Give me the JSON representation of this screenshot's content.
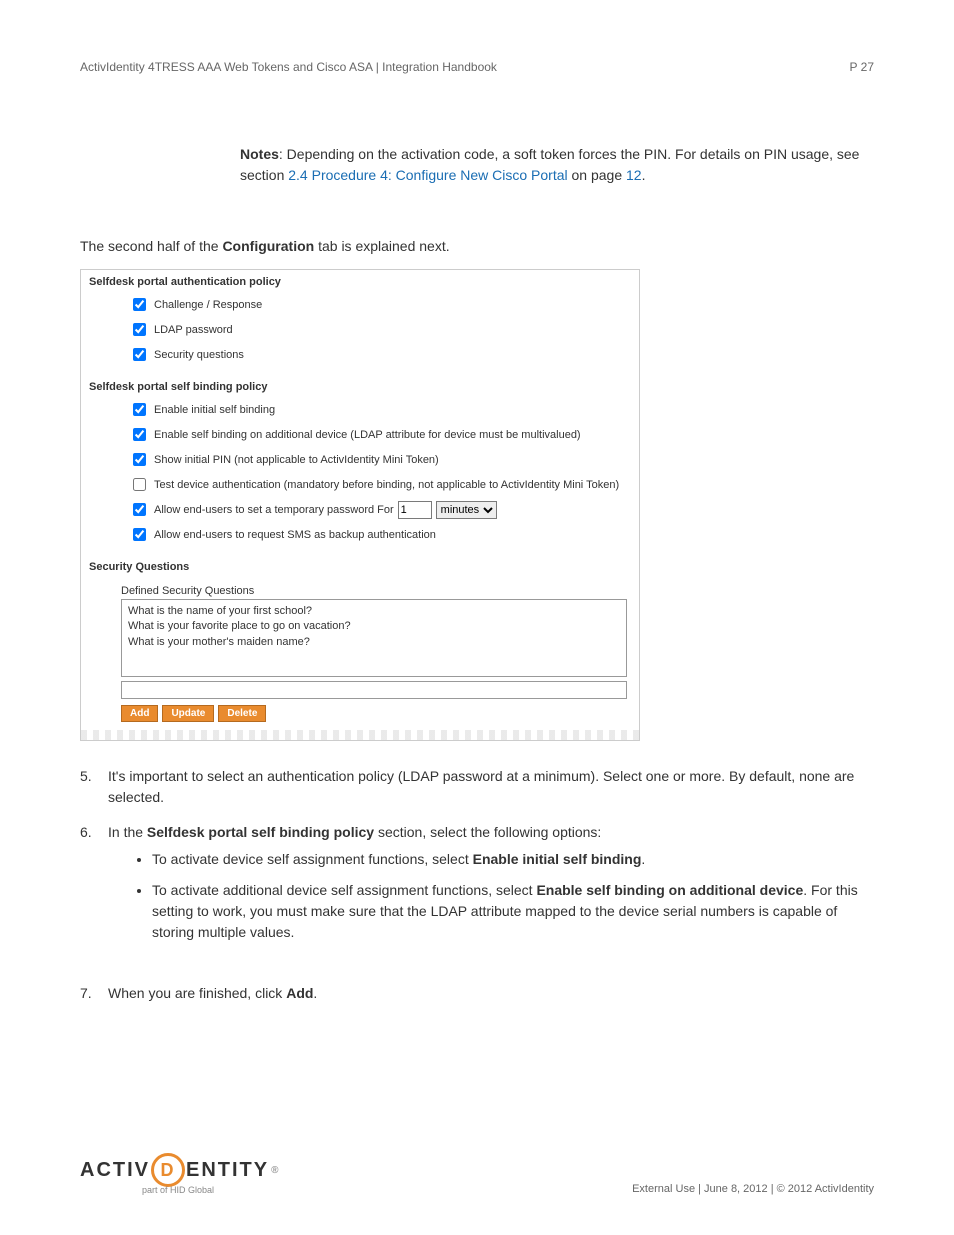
{
  "header": {
    "title": "ActivIdentity 4TRESS AAA Web Tokens and Cisco ASA | Integration Handbook",
    "page": "P 27"
  },
  "notes": {
    "label": "Notes",
    "text": ": Depending on the activation code, a soft token forces the PIN. For details on PIN usage, see section ",
    "link": "2.4 Procedure 4: Configure New Cisco Portal",
    "tail": " on page ",
    "page_ref": "12",
    "period": "."
  },
  "intro": {
    "pre": "The second half of the ",
    "bold": "Configuration",
    "post": " tab is explained next."
  },
  "screenshot": {
    "section1_title": "Selfdesk portal authentication policy",
    "auth": {
      "challenge": "Challenge / Response",
      "ldap": "LDAP password",
      "security_q": "Security questions"
    },
    "section2_title": "Selfdesk portal self binding policy",
    "bind": {
      "enable_initial": "Enable initial self binding",
      "enable_additional": "Enable self binding on additional device (LDAP attribute for device must be multivalued)",
      "show_pin": "Show initial PIN (not applicable to ActivIdentity Mini Token)",
      "test_device": "Test device authentication (mandatory before binding, not applicable to ActivIdentity Mini Token)",
      "allow_temp_pre": "Allow end-users to set a temporary password For",
      "temp_value": "1",
      "temp_unit": "minutes",
      "allow_sms": "Allow end-users to request SMS as backup authentication"
    },
    "section3_title": "Security Questions",
    "defined_label": "Defined Security Questions",
    "questions": {
      "q1": "What is the name of your first school?",
      "q2": "What is your favorite place to go on vacation?",
      "q3": "What is your mother's maiden name?"
    },
    "buttons": {
      "add": "Add",
      "update": "Update",
      "delete": "Delete"
    }
  },
  "steps": {
    "s5": {
      "num": "5.",
      "text": "It's important to select an authentication policy (LDAP password at a minimum). Select one or more. By default, none are selected."
    },
    "s6": {
      "num": "6.",
      "pre": "In the ",
      "bold": "Selfdesk portal self binding policy",
      "post": " section, select the following options:",
      "b1_pre": "To activate device self assignment functions, select ",
      "b1_bold": "Enable initial self binding",
      "b1_post": ".",
      "b2_pre": "To activate additional device self assignment functions, select ",
      "b2_bold": "Enable self binding on additional device",
      "b2_post": ". For this setting to work, you must make sure that the LDAP attribute mapped to the device serial numbers is capable of storing multiple values."
    },
    "s7": {
      "num": "7.",
      "pre": "When you are finished, click ",
      "bold": "Add",
      "post": "."
    }
  },
  "footer": {
    "logo_text_left": "ACTIV",
    "logo_d": "D",
    "logo_text_right": "ENTITY",
    "logo_sub": "part of HID Global",
    "right": "External Use | June 8, 2012 | © 2012 ActivIdentity"
  }
}
